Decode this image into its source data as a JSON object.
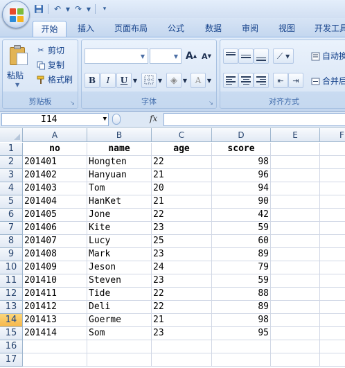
{
  "quick_access": {
    "icons": [
      "save-icon",
      "undo-icon",
      "redo-icon",
      "customize-icon"
    ]
  },
  "tabs": [
    "开始",
    "插入",
    "页面布局",
    "公式",
    "数据",
    "审阅",
    "视图",
    "开发工具"
  ],
  "active_tab": "开始",
  "ribbon": {
    "clipboard": {
      "paste": "粘贴",
      "cut": "剪切",
      "copy": "复制",
      "format_painter": "格式刷",
      "label": "剪贴板"
    },
    "font": {
      "font_name": "",
      "font_size": "",
      "grow": "A",
      "shrink": "A",
      "bold": "B",
      "italic": "I",
      "underline": "U",
      "font_color": "A",
      "label": "字体"
    },
    "alignment": {
      "wrap_text": "自动换",
      "merge": "合并后",
      "label": "对齐方式"
    }
  },
  "formula_bar": {
    "name_box": "I14",
    "fx": "fx",
    "formula": ""
  },
  "grid": {
    "columns": [
      "A",
      "B",
      "C",
      "D",
      "E",
      "F"
    ],
    "row_numbers": [
      "1",
      "2",
      "3",
      "4",
      "5",
      "6",
      "7",
      "8",
      "9",
      "10",
      "11",
      "12",
      "13",
      "14",
      "15",
      "16",
      "17"
    ],
    "selected_row": "14",
    "rows": [
      [
        "no",
        "name",
        "age",
        "score"
      ],
      [
        "201401",
        "Hongten",
        "22",
        "98"
      ],
      [
        "201402",
        "Hanyuan",
        "21",
        "96"
      ],
      [
        "201403",
        "Tom",
        "20",
        "94"
      ],
      [
        "201404",
        "HanKet",
        "21",
        "90"
      ],
      [
        "201405",
        "Jone",
        "22",
        "42"
      ],
      [
        "201406",
        "Kite",
        "23",
        "59"
      ],
      [
        "201407",
        "Lucy",
        "25",
        "60"
      ],
      [
        "201408",
        "Mark",
        "23",
        "89"
      ],
      [
        "201409",
        "Jeson",
        "24",
        "79"
      ],
      [
        "201410",
        "Steven",
        "23",
        "59"
      ],
      [
        "201411",
        "Tide",
        "22",
        "88"
      ],
      [
        "201412",
        "Deli",
        "22",
        "89"
      ],
      [
        "201413",
        "Goerme",
        "21",
        "98"
      ],
      [
        "201414",
        "Som",
        "23",
        "95"
      ],
      [
        "",
        "",
        "",
        ""
      ],
      [
        "",
        "",
        "",
        ""
      ]
    ]
  }
}
